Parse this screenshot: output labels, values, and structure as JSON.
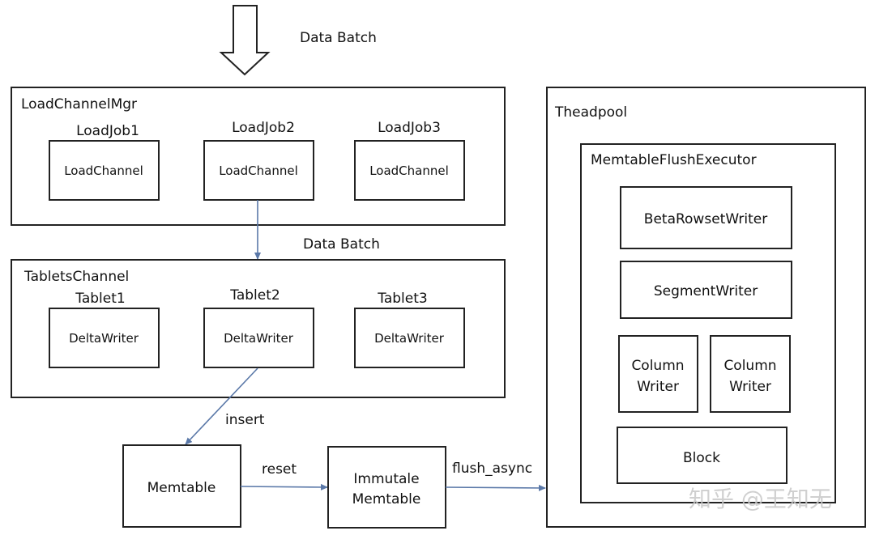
{
  "input_label": "Data Batch",
  "load_channel_mgr": {
    "title": "LoadChannelMgr",
    "jobs": [
      {
        "label": "LoadJob1",
        "channel": "LoadChannel"
      },
      {
        "label": "LoadJob2",
        "channel": "LoadChannel"
      },
      {
        "label": "LoadJob3",
        "channel": "LoadChannel"
      }
    ]
  },
  "edge_data_batch": "Data Batch",
  "tablets_channel": {
    "title": "TabletsChannel",
    "tablets": [
      {
        "label": "Tablet1",
        "writer": "DeltaWriter"
      },
      {
        "label": "Tablet2",
        "writer": "DeltaWriter"
      },
      {
        "label": "Tablet3",
        "writer": "DeltaWriter"
      }
    ]
  },
  "edge_insert": "insert",
  "memtable": "Memtable",
  "edge_reset": "reset",
  "immutable_memtable": [
    "Immutale",
    "Memtable"
  ],
  "edge_flush": "flush_async",
  "threadpool": {
    "title": "Theadpool",
    "executor": {
      "title": "MemtableFlushExecutor",
      "beta_rowset_writer": "BetaRowsetWriter",
      "segment_writer": "SegmentWriter",
      "column_writers": [
        [
          "Column",
          "Writer"
        ],
        [
          "Column",
          "Writer"
        ]
      ],
      "block": "Block"
    }
  },
  "watermark": "知乎 @王知无",
  "colors": {
    "edge": "#5a78a8",
    "border": "#222222"
  }
}
